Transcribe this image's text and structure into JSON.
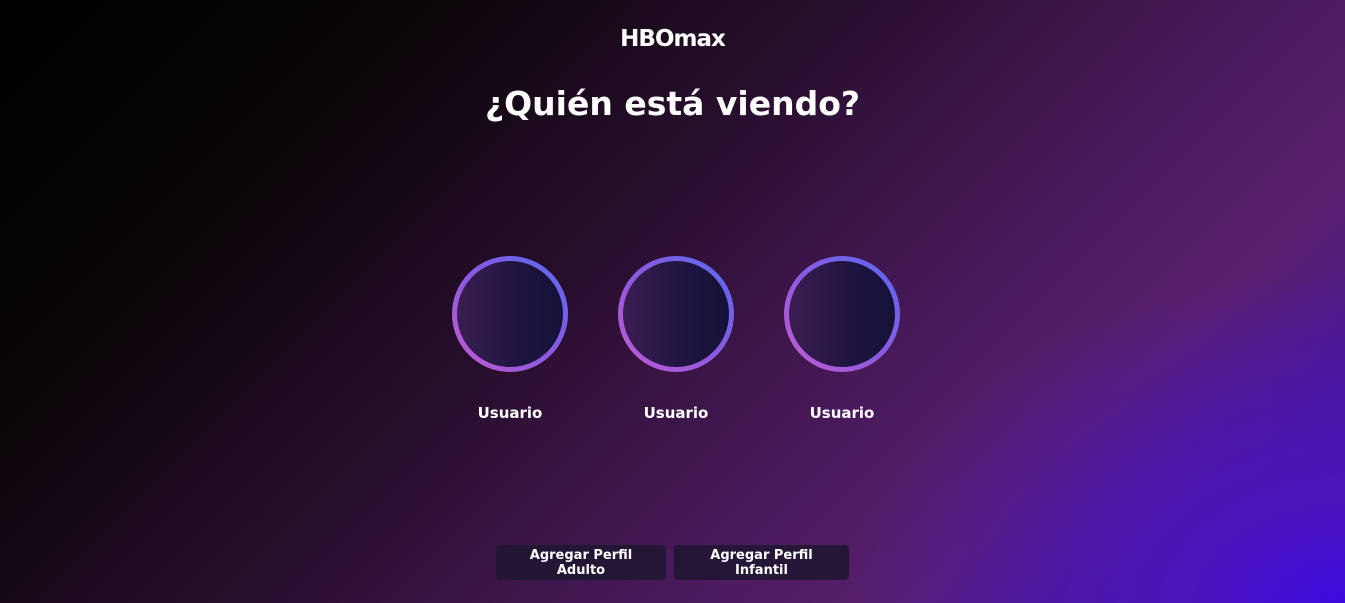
{
  "logo": {
    "text": "HBOmax"
  },
  "page": {
    "title": "¿Quién está viendo?"
  },
  "profiles": [
    {
      "name": "Usuario"
    },
    {
      "name": "Usuario"
    },
    {
      "name": "Usuario"
    }
  ],
  "actions": {
    "add_adult_label": "Agregar Perfil Adulto",
    "add_kids_label": "Agregar Perfil Infantil"
  },
  "colors": {
    "ring_start": "#c45ad0",
    "ring_end": "#5a6af0",
    "button_bg": "#1e1630",
    "accent_blue": "#3f0ae0"
  }
}
